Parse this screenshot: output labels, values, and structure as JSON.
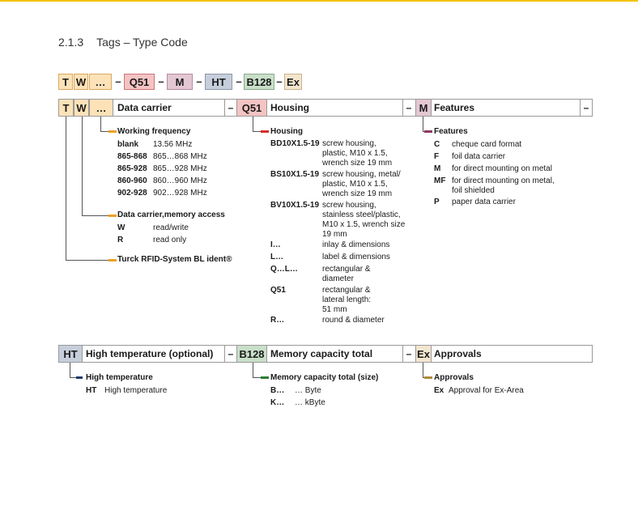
{
  "title": {
    "number": "2.1.3",
    "text": "Tags – Type Code"
  },
  "code": {
    "t": "T",
    "w": "W",
    "dots": "…",
    "dash": "–",
    "q51": "Q51",
    "m": "M",
    "ht": "HT",
    "b128": "B128",
    "ex": "Ex"
  },
  "row1": {
    "data_carrier": "Data carrier",
    "housing": "Housing",
    "features": "Features"
  },
  "row2": {
    "high_temp": "High temperature (optional)",
    "memory": "Memory capacity total",
    "approvals": "Approvals"
  },
  "wf": {
    "title": "Working frequency",
    "rows": [
      {
        "code": "blank",
        "desc": "13.56 MHz"
      },
      {
        "code": "865-868",
        "desc": "865…868 MHz"
      },
      {
        "code": "865-928",
        "desc": "865…928 MHz"
      },
      {
        "code": "860-960",
        "desc": "860…960 MHz"
      },
      {
        "code": "902-928",
        "desc": "902…928 MHz"
      }
    ]
  },
  "mem": {
    "title": "Data carrier,memory access",
    "rows": [
      {
        "code": "W",
        "desc": "read/write"
      },
      {
        "code": "R",
        "desc": "read only"
      }
    ]
  },
  "ident": {
    "title": "Turck RFID-System BL ident®"
  },
  "housing": {
    "title": "Housing",
    "rows": [
      {
        "code": "BD10X1.5-19",
        "l1": "screw housing,",
        "l2": "plastic, M10 x 1.5,",
        "l3": "wrench size 19 mm"
      },
      {
        "code": "BS10X1.5-19",
        "l1": "screw housing, metal/",
        "l2": "plastic, M10 x 1.5,",
        "l3": "wrench size 19 mm"
      },
      {
        "code": "BV10X1.5-19",
        "l1": "screw housing,",
        "l2": "stainless steel/plastic,",
        "l3": "M10 x 1.5, wrench size",
        "l4": "19 mm"
      },
      {
        "code": "I…",
        "l1": "inlay & dimensions"
      },
      {
        "code": "L…",
        "l1": "label & dimensions"
      },
      {
        "code": "Q…L…",
        "l1": "rectangular &",
        "l2": "diameter"
      },
      {
        "code": "Q51",
        "l1": "rectangular &",
        "l2": "lateral length:",
        "l3": "51 mm"
      },
      {
        "code": "R…",
        "l1": "round & diameter"
      }
    ]
  },
  "features": {
    "title": "Features",
    "rows": [
      {
        "code": "C",
        "l1": "cheque card format"
      },
      {
        "code": "F",
        "l1": "foil data carrier"
      },
      {
        "code": "M",
        "l1": "for direct mounting on metal"
      },
      {
        "code": "MF",
        "l1": "for direct mounting on metal,",
        "l2": "foil shielded"
      },
      {
        "code": "P",
        "l1": "paper data carrier"
      }
    ]
  },
  "ht": {
    "title": "High temperature",
    "rows": [
      {
        "code": "HT",
        "desc": "High temperature"
      }
    ]
  },
  "memcap": {
    "title": "Memory capacity total (size)",
    "rows": [
      {
        "code": "B…",
        "desc": "… Byte"
      },
      {
        "code": "K…",
        "desc": "… kByte"
      }
    ]
  },
  "approvals": {
    "title": "Approvals",
    "rows": [
      {
        "code": "Ex",
        "desc": "Approval for Ex-Area"
      }
    ]
  },
  "colors": {
    "accent": "#f2c200",
    "yellow": "#f0a020",
    "red": "#d82c2c",
    "purple": "#8e3a5e",
    "blue": "#1f3b6e",
    "green": "#2e7d32",
    "tan": "#b08a3a"
  }
}
